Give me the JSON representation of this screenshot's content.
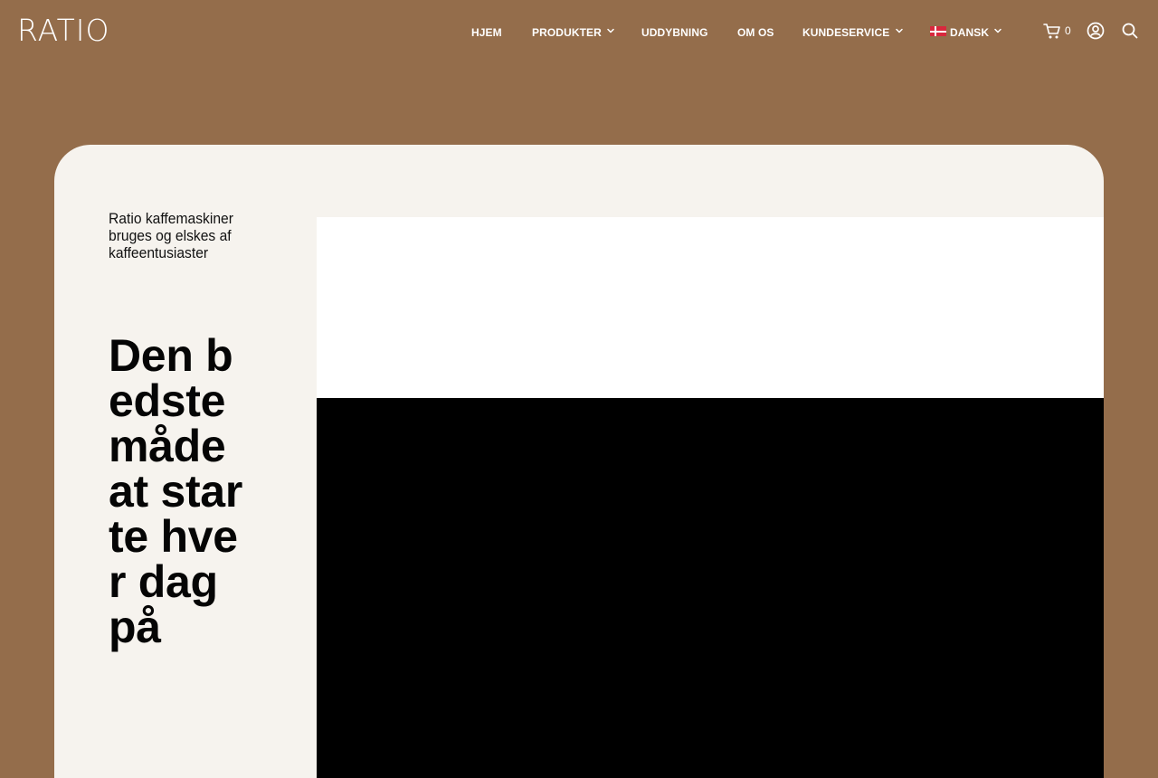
{
  "brand": {
    "logo_text": "RATIO"
  },
  "nav": {
    "items": [
      {
        "label": "HJEM"
      },
      {
        "label": "PRODUKTER"
      },
      {
        "label": "UDDYBNING"
      },
      {
        "label": "OM OS"
      },
      {
        "label": "KUNDESERVICE"
      },
      {
        "label": "DANSK"
      }
    ]
  },
  "cart": {
    "count": "0"
  },
  "icons": {
    "cart": "shopping-cart-icon",
    "account": "user-icon",
    "search": "search-icon",
    "chevron": "chevron-down-icon",
    "flag": "danish-flag-icon"
  },
  "hero": {
    "eyebrow": "Ratio kaffemaskiner bruges og elskes af kaffeentusiaster",
    "headline": "Den bedste måde at starte hver dag på"
  },
  "colors": {
    "background": "#946d4b",
    "card": "#f6f3ee",
    "text_light": "#ffffff",
    "text_dark": "#050505"
  }
}
